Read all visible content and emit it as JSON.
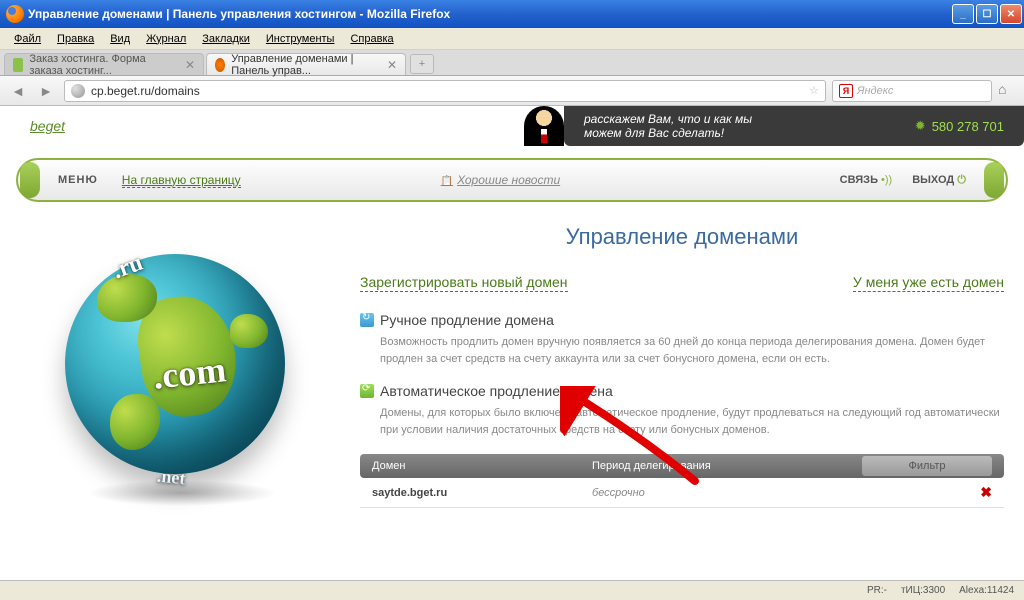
{
  "titlebar": {
    "title": "Управление доменами | Панель управления хостингом - Mozilla Firefox"
  },
  "menubar": {
    "file": "Файл",
    "edit": "Правка",
    "view": "Вид",
    "history": "Журнал",
    "bookmarks": "Закладки",
    "tools": "Инструменты",
    "help": "Справка"
  },
  "tabs": {
    "tab1": "Заказ хостинга. Форма заказа хостинг...",
    "tab2": "Управление доменами | Панель управ..."
  },
  "addrbar": {
    "url": "cp.beget.ru/domains",
    "search_placeholder": "Яндекс"
  },
  "banner": {
    "logo": "beget",
    "slogan_line1": "расскажем Вам, что и как мы",
    "slogan_line2": "можем для Вас сделать!",
    "phone": "580 278 701"
  },
  "nav": {
    "menu": "МЕНЮ",
    "home": "На главную страницу",
    "news": "Хорошие новости",
    "contact": "СВЯЗЬ",
    "exit": "ВЫХОД"
  },
  "page": {
    "title": "Управление доменами",
    "register_link": "Зарегистрировать новый домен",
    "have_domain_link": "У меня уже есть домен",
    "manual_title": "Ручное продление домена",
    "manual_text": "Возможность продлить домен вручную появляется за 60 дней до конца периода делегирования домена. Домен будет продлен за счет средств на счету аккаунта или за счет бонусного домена, если он есть.",
    "auto_title": "Автоматическое продление домена",
    "auto_text": "Домены, для которых было включено автоматическое продление, будут продлеваться на следующий год автоматически при условии наличия достаточных средств на счету или бонусных доменов."
  },
  "table": {
    "th_domain": "Домен",
    "th_period": "Период делегирования",
    "th_filter": "Фильтр",
    "rows": [
      {
        "domain": "saytde.bget.ru",
        "period": "бессрочно"
      }
    ]
  },
  "statusbar": {
    "pr": "PR:-",
    "tic": "тИЦ:3300",
    "alexa": "Alexa:11424"
  },
  "globe": {
    "ru": ".ru",
    "com": ".com",
    "net": ".net"
  }
}
